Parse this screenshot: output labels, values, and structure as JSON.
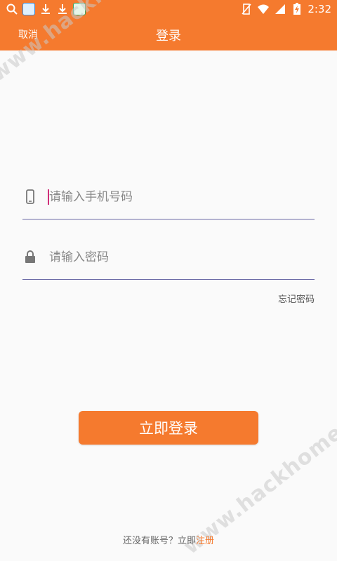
{
  "statusbar": {
    "time": "2:32",
    "left_icons": [
      "search-icon",
      "app-icon",
      "download-icon",
      "download-icon",
      "app-icon"
    ],
    "right_icons": [
      "no-sim-icon",
      "wifi-icon",
      "signal-icon",
      "battery-charging-icon"
    ]
  },
  "header": {
    "cancel_label": "取消",
    "title": "登录",
    "color": "#f57a2e"
  },
  "form": {
    "phone_placeholder": "请输入手机号码",
    "phone_icon": "phone-icon",
    "password_placeholder": "请输入密码",
    "password_icon": "lock-icon",
    "forgot_label": "忘记密码"
  },
  "login_button": {
    "label": "立即登录"
  },
  "footer": {
    "prompt": "还没有账号？立即",
    "register_label": "注册"
  },
  "watermark": {
    "text": "www.hackhome.com"
  }
}
